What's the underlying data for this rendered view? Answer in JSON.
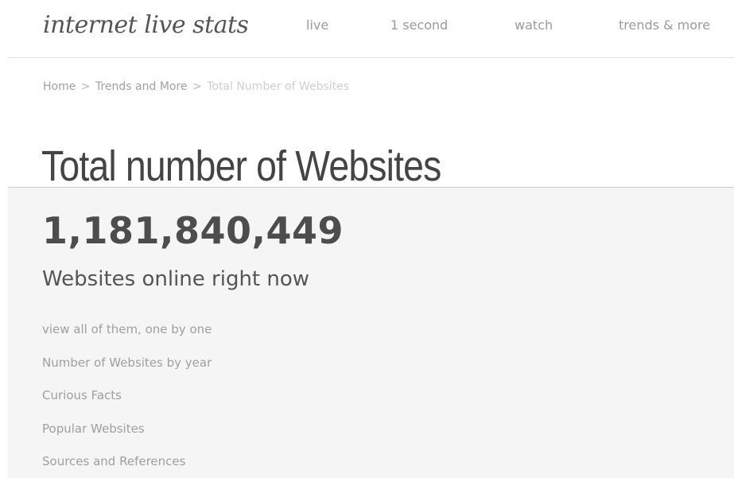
{
  "header": {
    "logo": "internet live stats",
    "nav": [
      "live",
      "1 second",
      "watch",
      "trends & more"
    ]
  },
  "breadcrumb": {
    "home": "Home",
    "separator": ">",
    "trends": "Trends and More",
    "current": "Total Number of Websites"
  },
  "page": {
    "title": "Total number of Websites"
  },
  "counter": {
    "value": "1,181,840,449",
    "label": "Websites online right now"
  },
  "links": [
    "view all of them, one by one",
    "Number of Websites by year",
    "Curious Facts",
    "Popular Websites",
    "Sources and References"
  ],
  "colors": {
    "background": "#ffffff",
    "panel": "#f5f5f5",
    "text_dark": "#444444",
    "text_muted": "#9f9f9f"
  }
}
